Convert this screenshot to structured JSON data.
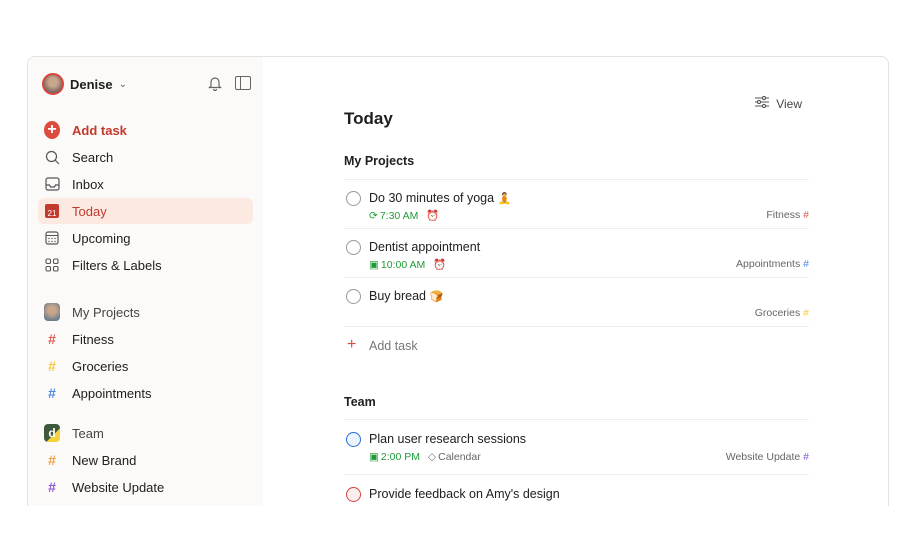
{
  "sidebar": {
    "user": "Denise",
    "nav": [
      {
        "label": "Add task"
      },
      {
        "label": "Search"
      },
      {
        "label": "Inbox"
      },
      {
        "label": "Today",
        "date": "21"
      },
      {
        "label": "Upcoming"
      },
      {
        "label": "Filters & Labels"
      }
    ],
    "my_projects": {
      "label": "My Projects",
      "items": [
        {
          "label": "Fitness",
          "color": "#e05a4f"
        },
        {
          "label": "Groceries",
          "color": "#f5c83b"
        },
        {
          "label": "Appointments",
          "color": "#4f86e0"
        }
      ]
    },
    "team": {
      "label": "Team",
      "items": [
        {
          "label": "New Brand",
          "color": "#f0a040"
        },
        {
          "label": "Website Update",
          "color": "#8a5ad6"
        }
      ]
    }
  },
  "main": {
    "view_label": "View",
    "title": "Today",
    "sections": [
      {
        "label": "My Projects",
        "tasks": [
          {
            "title": "Do 30 minutes of yoga",
            "emoji": "🧘",
            "time": "7:30 AM",
            "project": "Fitness",
            "project_color": "#e05a4f"
          },
          {
            "title": "Dentist appointment",
            "time": "10:00 AM",
            "project": "Appointments",
            "project_color": "#4f86e0"
          },
          {
            "title": "Buy bread",
            "emoji": "🍞",
            "project": "Groceries",
            "project_color": "#f5c83b"
          }
        ],
        "add_task": "Add task"
      },
      {
        "label": "Team",
        "tasks": [
          {
            "title": "Plan user research sessions",
            "time": "2:00 PM",
            "label": "Calendar",
            "project": "Website Update",
            "project_color": "#8a5ad6"
          },
          {
            "title": "Provide feedback on Amy's design"
          }
        ]
      }
    ]
  }
}
